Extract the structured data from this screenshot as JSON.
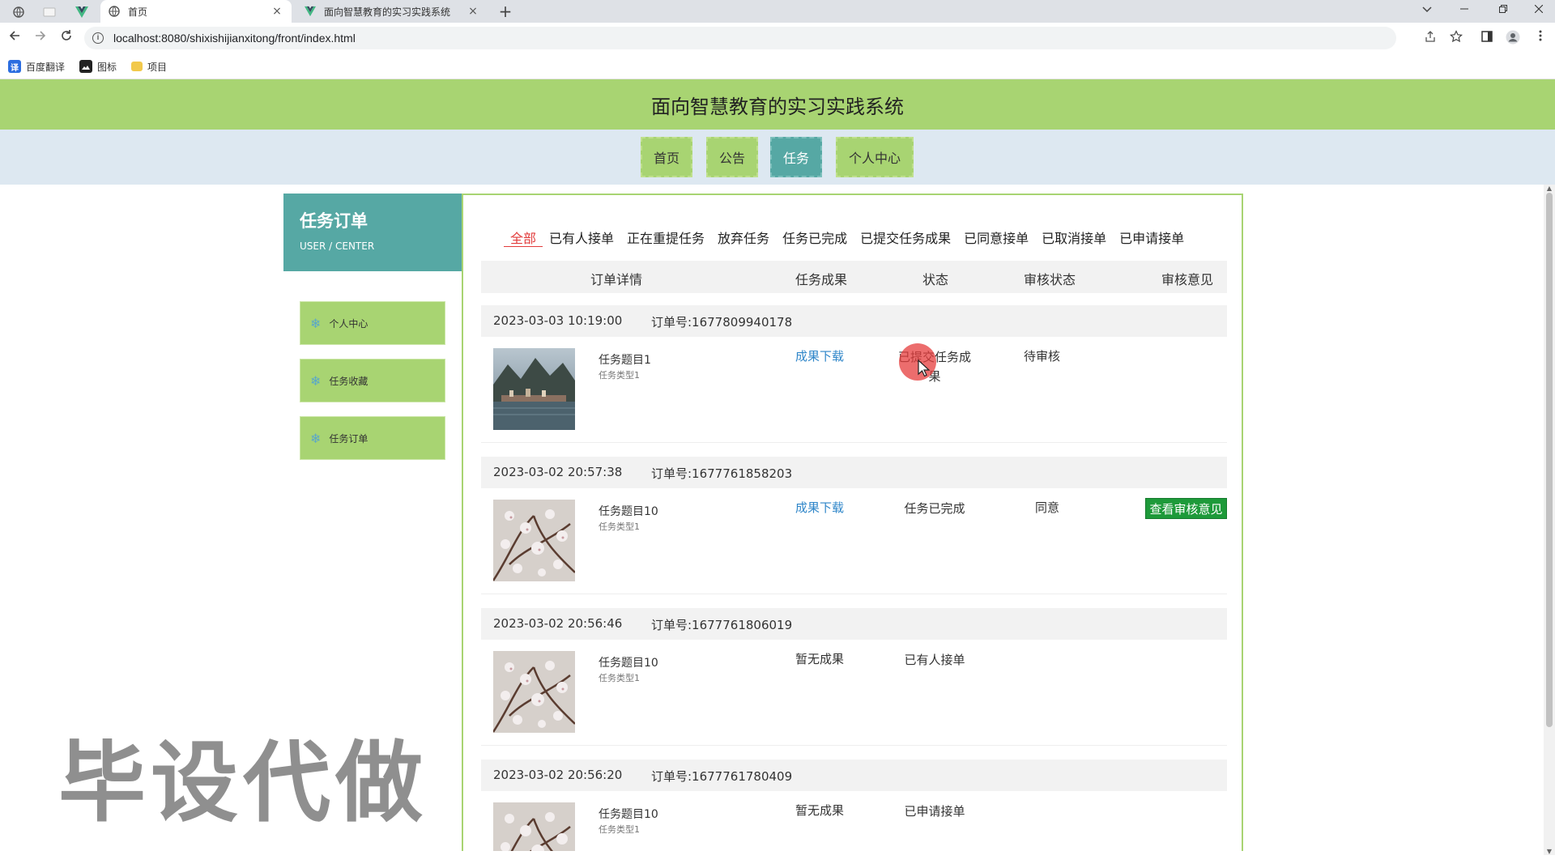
{
  "browser": {
    "tabs": [
      {
        "title": "首页",
        "close": "×",
        "active": true
      },
      {
        "title": "面向智慧教育的实习实践系统",
        "close": "×",
        "active": false
      }
    ],
    "new_tab": "+",
    "url": "localhost:8080/shixishijianxitong/front/index.html",
    "bookmarks": [
      {
        "label": "百度翻译",
        "icon": "translate-icon",
        "color": "#2b6de0"
      },
      {
        "label": "图标",
        "icon": "image-icon",
        "color": "#222222"
      },
      {
        "label": "项目",
        "icon": "folder-icon",
        "color": "#f2c94c"
      }
    ]
  },
  "site": {
    "title": "面向智慧教育的实习实践系统",
    "nav": [
      {
        "label": "首页",
        "active": false
      },
      {
        "label": "公告",
        "active": false
      },
      {
        "label": "任务",
        "active": true
      },
      {
        "label": "个人中心",
        "active": false
      }
    ]
  },
  "sidebar": {
    "title": "任务订单",
    "subtitle": "USER / CENTER",
    "items": [
      {
        "label": "个人中心",
        "icon": "snowflake-icon"
      },
      {
        "label": "任务收藏",
        "icon": "snowflake-icon"
      },
      {
        "label": "任务订单",
        "icon": "snowflake-icon"
      }
    ]
  },
  "filters": [
    "全部",
    "已有人接单",
    "正在重提任务",
    "放弃任务",
    "任务已完成",
    "已提交任务成果",
    "已同意接单",
    "已取消接单",
    "已申请接单"
  ],
  "active_filter": "全部",
  "columns": {
    "detail": "订单详情",
    "result": "任务成果",
    "status": "状态",
    "review_status": "审核状态",
    "review_opinion": "审核意见"
  },
  "orders": [
    {
      "time": "2023-03-03 10:19:00",
      "order_no": "订单号:1677809940178",
      "name": "任务题目1",
      "type": "任务类型1",
      "result": "成果下载",
      "status": "已提交任务成果",
      "review_status": "待审核",
      "review_opinion": ""
    },
    {
      "time": "2023-03-02 20:57:38",
      "order_no": "订单号:1677761858203",
      "name": "任务题目10",
      "type": "任务类型1",
      "result": "成果下载",
      "status": "任务已完成",
      "review_status": "同意",
      "review_opinion": "查看审核意见"
    },
    {
      "time": "2023-03-02 20:56:46",
      "order_no": "订单号:1677761806019",
      "name": "任务题目10",
      "type": "任务类型1",
      "result": "暂无成果",
      "status": "已有人接单",
      "review_status": "",
      "review_opinion": ""
    },
    {
      "time": "2023-03-02 20:56:20",
      "order_no": "订单号:1677761780409",
      "name": "任务题目10",
      "type": "任务类型1",
      "result": "暂无成果",
      "status": "已申请接单",
      "review_status": "",
      "review_opinion": ""
    }
  ],
  "watermark": "毕设代做",
  "colors": {
    "header_green": "#a8d472",
    "teal": "#56a8a4",
    "nav_bg": "#dde8f1",
    "link_blue": "#2f86c9",
    "active_red": "#e23c3c",
    "button_green": "#1e9a3a"
  }
}
